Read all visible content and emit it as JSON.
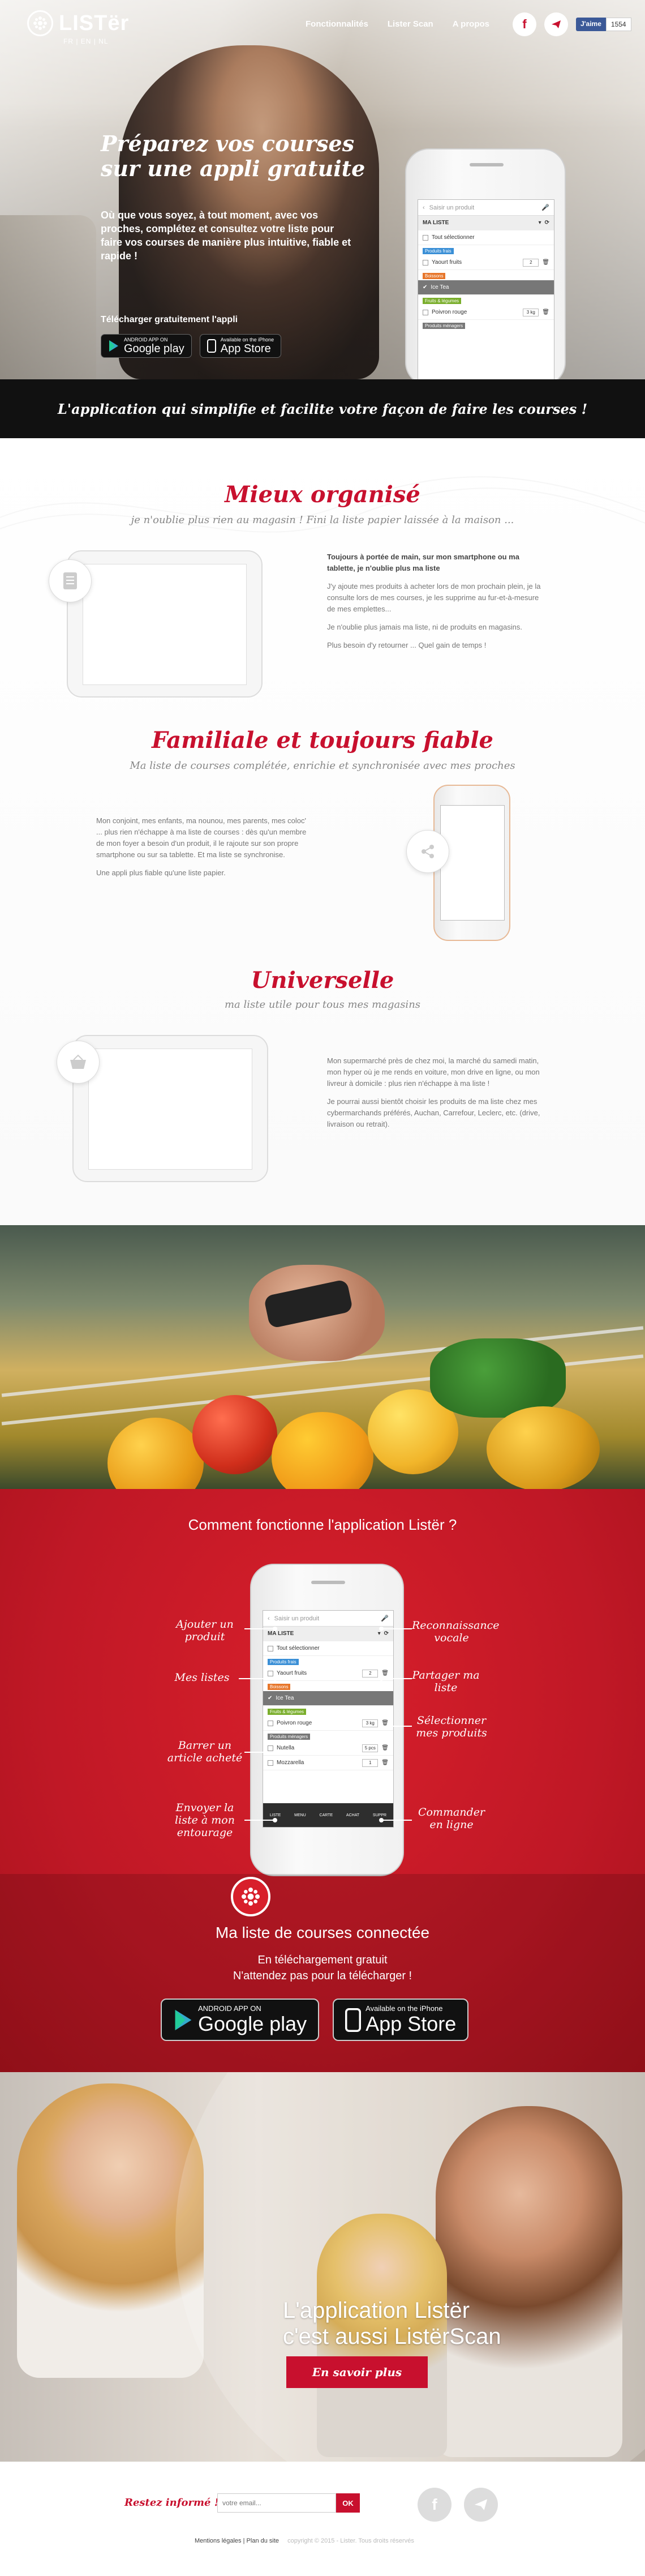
{
  "brand": {
    "name": "LISTër",
    "languages": "FR | EN | NL"
  },
  "nav": [
    "Fonctionnalités",
    "Lister Scan",
    "A propos"
  ],
  "social": {
    "like_label": "J'aime",
    "like_count": "1554"
  },
  "hero": {
    "title": "Préparez vos courses sur une appli gratuite",
    "text": "Où que vous soyez, à tout moment, avec vos proches, complétez et consultez votre liste pour faire vos courses de manière plus intuitive, fiable et rapide !",
    "download_label": "Télécharger gratuitement l'appli",
    "google_small": "ANDROID APP ON",
    "google_big": "Google play",
    "apple_small": "Available on the iPhone",
    "apple_big": "App Store"
  },
  "app": {
    "search_placeholder": "Saisir un produit",
    "list_name": "MA LISTE",
    "select_all": "Tout sélectionner",
    "cat_fresh": "Produits frais",
    "item1": "Yaourt fruits",
    "item1_qty": "2",
    "cat_drinks": "Boissons",
    "item2": "Ice Tea",
    "cat_fruits": "Fruits & légumes",
    "item3": "Poivron rouge",
    "item3_qty": "3 kg",
    "cat_cleaning": "Produits ménagers",
    "item4": "Nutella",
    "item4_qty": "5 pcs",
    "item5": "Mozzarella",
    "item5_qty": "1",
    "tabs": [
      "LISTE",
      "MENU",
      "CARTE",
      "ACHAT",
      "SUPPR"
    ]
  },
  "banner": "L'application qui simplifie et facilite votre façon de faire les courses !",
  "features": [
    {
      "title": "Mieux organisé",
      "subtitle": "je n'oublie plus rien au magasin ! Fini la liste papier laissée à la maison ...",
      "lead": "Toujours à portée de main, sur mon smartphone ou ma tablette, je n'oublie plus ma liste",
      "p1": "J'y ajoute mes produits à acheter lors de mon prochain plein, je la consulte lors de mes courses, je les supprime au fur-et-à-mesure de mes emplettes...",
      "p2": "Je n'oublie plus jamais ma liste, ni de produits en magasins.",
      "p3": "Plus besoin d'y retourner ... Quel gain de temps !"
    },
    {
      "title": "Familiale et toujours fiable",
      "subtitle": "Ma liste de courses complétée, enrichie et synchronisée avec mes proches",
      "p1": "Mon conjoint, mes enfants, ma nounou, mes parents, mes coloc' ... plus rien n'échappe à ma liste de courses : dès qu'un membre de mon foyer a besoin d'un produit, il le rajoute sur son propre smartphone ou sur sa tablette. Et ma liste se synchronise.",
      "p2": "Une appli plus fiable qu'une liste papier."
    },
    {
      "title": "Universelle",
      "subtitle": "ma liste utile pour tous mes magasins",
      "p1": "Mon supermarché près de chez moi, la marché du samedi matin, mon hyper où je me rends en voiture, mon drive en ligne, ou mon livreur à domicile : plus rien n'échappe à ma liste !",
      "p2": "Je pourrai aussi bientôt choisir les produits de ma liste chez mes cybermarchands préférés, Auchan, Carrefour, Leclerc, etc. (drive, livraison ou retrait)."
    }
  ],
  "how": {
    "title": "Comment fonctionne l'application Listër ?",
    "left": [
      "Ajouter un produit",
      "Mes listes",
      "Barrer un article acheté",
      "Envoyer la liste à mon entourage"
    ],
    "right": [
      "Reconnaissance vocale",
      "Partager ma liste",
      "Sélectionner mes produits",
      "Commander en ligne"
    ],
    "connected_title": "Ma liste de courses connectée",
    "connected_sub1": "En téléchargement gratuit",
    "connected_sub2": "N'attendez pas pour la télécharger !"
  },
  "scan": {
    "title1": "L'application Listër",
    "title2": "c'est aussi ListërScan",
    "button": "En savoir plus"
  },
  "footer": {
    "news_label": "Restez informé !",
    "email_placeholder": "votre email...",
    "ok": "OK",
    "legal": "Mentions légales",
    "sitemap": "Plan du site",
    "copyright": "copyright © 2015 - Lister. Tous droits réservés"
  },
  "colors": {
    "brand_red": "#c8102e",
    "dark_banner": "#111111"
  }
}
